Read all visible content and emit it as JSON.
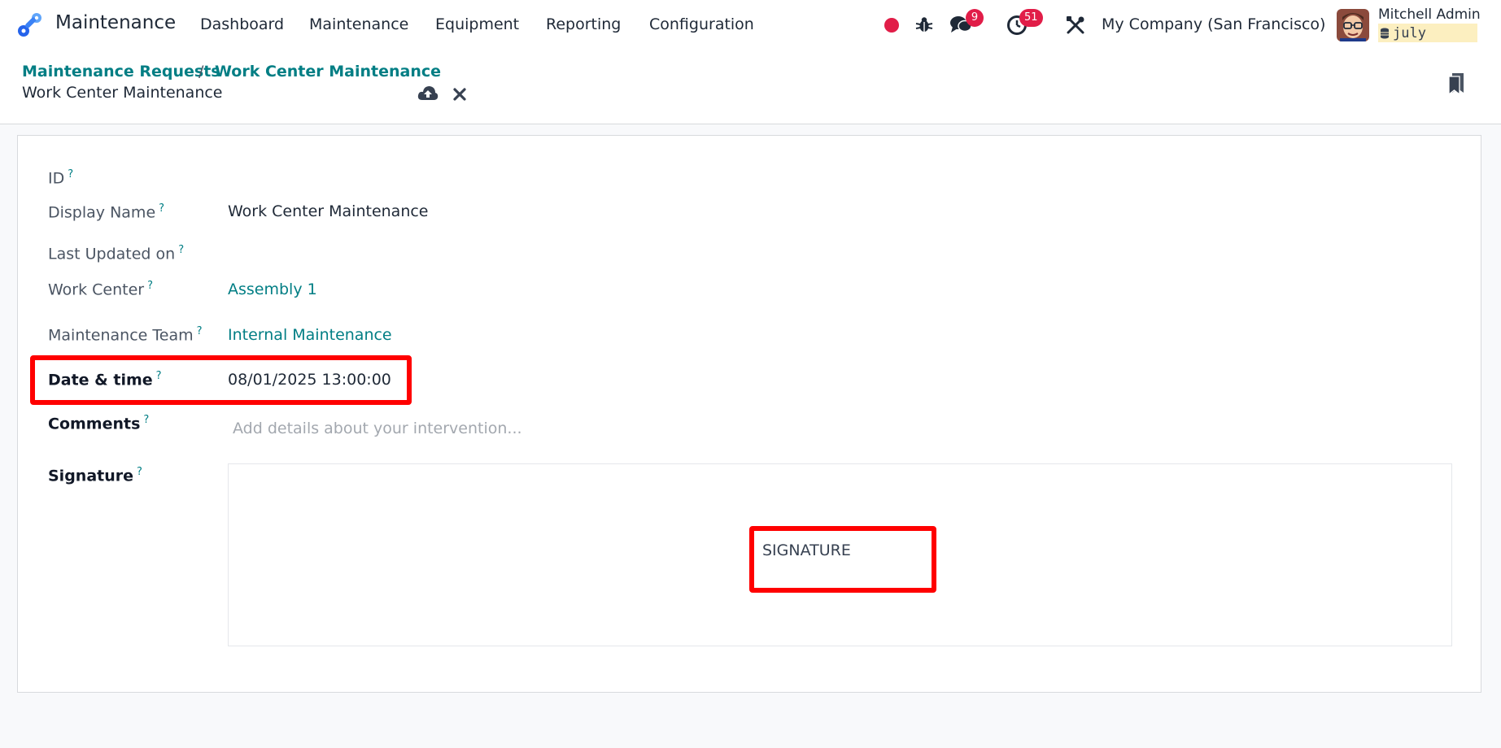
{
  "navbar": {
    "app_name": "Maintenance",
    "menu": [
      "Dashboard",
      "Maintenance",
      "Equipment",
      "Reporting",
      "Configuration"
    ],
    "messages_count": "9",
    "activities_count": "51",
    "company": "My Company (San Francisco)",
    "user_name": "Mitchell Admin",
    "database": "july",
    "icons": [
      "record-dot",
      "bug",
      "chat-bubbles",
      "clock",
      "tools"
    ],
    "colors": {
      "accent": "#017e84",
      "badge": "#e11d48",
      "record": "#e11d48"
    }
  },
  "control_panel": {
    "breadcrumb": [
      "Maintenance Requests",
      "Work Center Maintenance"
    ],
    "separator": "/",
    "current": "Work Center Maintenance"
  },
  "form": {
    "fields": {
      "id": {
        "label": "ID",
        "value": ""
      },
      "display_name": {
        "label": "Display Name",
        "value": "Work Center Maintenance"
      },
      "last_updated": {
        "label": "Last Updated on",
        "value": ""
      },
      "work_center": {
        "label": "Work Center",
        "value": "Assembly 1"
      },
      "maintenance_team": {
        "label": "Maintenance Team",
        "value": "Internal Maintenance"
      },
      "date_time": {
        "label": "Date & time",
        "value": "08/01/2025 13:00:00"
      },
      "comments": {
        "label": "Comments",
        "placeholder": "Add details about your intervention..."
      },
      "signature": {
        "label": "Signature",
        "button": "SIGNATURE"
      }
    },
    "help_mark": "?"
  },
  "annotations": {
    "highlight_color": "#ff0000"
  }
}
